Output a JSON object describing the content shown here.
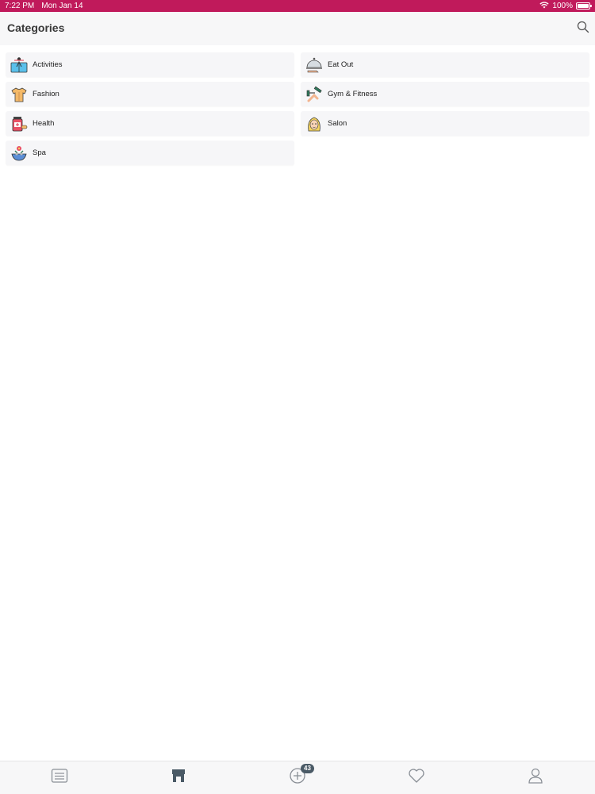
{
  "status_bar": {
    "time": "7:22 PM",
    "date": "Mon Jan 14",
    "battery": "100%",
    "battery_level": 1.0
  },
  "header": {
    "title": "Categories",
    "search_icon": "search-icon"
  },
  "categories": [
    {
      "label": "Activities",
      "icon": "activities-icon"
    },
    {
      "label": "Eat Out",
      "icon": "eat-out-icon"
    },
    {
      "label": "Fashion",
      "icon": "fashion-icon"
    },
    {
      "label": "Gym & Fitness",
      "icon": "gym-fitness-icon"
    },
    {
      "label": "Health",
      "icon": "health-icon"
    },
    {
      "label": "Salon",
      "icon": "salon-icon"
    },
    {
      "label": "Spa",
      "icon": "spa-icon"
    }
  ],
  "tab_bar": {
    "tabs": [
      {
        "icon": "list-icon"
      },
      {
        "icon": "store-icon",
        "active": true
      },
      {
        "icon": "add-circle-icon",
        "badge": "43"
      },
      {
        "icon": "heart-icon"
      },
      {
        "icon": "profile-icon"
      }
    ]
  },
  "colors": {
    "status_bar": "#c01a5b",
    "header_bg": "#f7f7f8",
    "card_bg": "#f6f6f8",
    "tab_active": "#4a5a66",
    "tab_inactive": "#8a8f96"
  }
}
